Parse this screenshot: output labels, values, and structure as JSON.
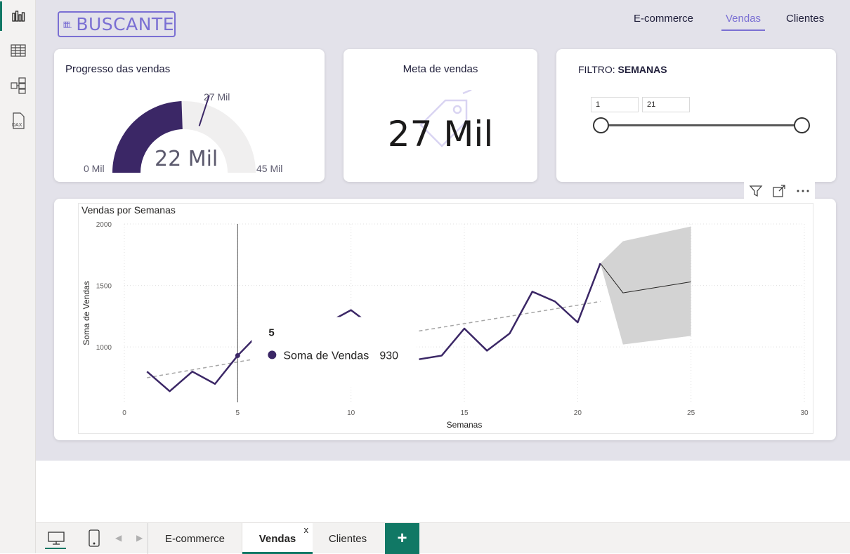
{
  "app": {
    "logo_text": "BUSCANTE",
    "nav": [
      {
        "label": "E-commerce"
      },
      {
        "label": "Vendas"
      },
      {
        "label": "Clientes"
      }
    ]
  },
  "left_rail": {
    "items": [
      {
        "icon": "report-view-icon"
      },
      {
        "icon": "table-view-icon"
      },
      {
        "icon": "model-view-icon"
      },
      {
        "icon": "dax-query-icon"
      }
    ]
  },
  "gauge_card": {
    "title": "Progresso das vendas",
    "value_label": "22 Mil",
    "min_label": "0 Mil",
    "max_label": "45 Mil",
    "target_label": "27 Mil",
    "value": 22,
    "min": 0,
    "max": 45,
    "target": 27,
    "fill_color": "#3b2766"
  },
  "kpi_card": {
    "title": "Meta de vendas",
    "value": "27 Mil",
    "icon": "price-tag-icon"
  },
  "filter_card": {
    "title_prefix": "FILTRO: ",
    "title_bold": "SEMANAS",
    "range_min": "1",
    "range_max": "21"
  },
  "visual_header": {
    "icons": [
      "filter-icon",
      "focus-mode-icon",
      "more-options-icon"
    ]
  },
  "chart_data": {
    "type": "line",
    "title": "Vendas por Semanas",
    "xlabel": "Semanas",
    "ylabel": "Soma de Vendas",
    "xlim": [
      0,
      30
    ],
    "ylim": [
      550,
      2000
    ],
    "x_ticks": [
      "0",
      "5",
      "10",
      "15",
      "20",
      "25",
      "30"
    ],
    "y_ticks": [
      "1000",
      "1500",
      "2000"
    ],
    "series": [
      {
        "name": "Soma de Vendas",
        "color": "#3b2766",
        "points": [
          [
            1,
            800
          ],
          [
            2,
            640
          ],
          [
            3,
            800
          ],
          [
            4,
            700
          ],
          [
            5,
            930
          ],
          [
            6,
            1120
          ],
          [
            7,
            null
          ],
          [
            8,
            null
          ],
          [
            9,
            1200
          ],
          [
            10,
            1300
          ],
          [
            11,
            1160
          ],
          [
            12,
            null
          ],
          [
            13,
            900
          ],
          [
            14,
            930
          ],
          [
            15,
            1150
          ],
          [
            16,
            970
          ],
          [
            17,
            1110
          ],
          [
            18,
            1450
          ],
          [
            19,
            1370
          ],
          [
            20,
            1200
          ],
          [
            21,
            1680
          ]
        ]
      }
    ],
    "trend_segments": [
      [
        [
          1,
          750
        ],
        [
          6,
          910
        ]
      ],
      [
        [
          13,
          1130
        ],
        [
          21,
          1370
        ]
      ]
    ],
    "forecast": {
      "color": "#d3d3d3",
      "line": [
        [
          21,
          1680
        ],
        [
          22,
          1440
        ],
        [
          25,
          1530
        ]
      ],
      "upper": [
        [
          21,
          1680
        ],
        [
          22,
          1860
        ],
        [
          25,
          1980
        ]
      ],
      "lower": [
        [
          21,
          1680
        ],
        [
          22,
          1020
        ],
        [
          25,
          1090
        ]
      ]
    },
    "hover_x": 5,
    "tooltip": {
      "header": "5",
      "series_label": "Soma de Vendas",
      "value": "930"
    }
  },
  "page_tabs": {
    "tabs": [
      {
        "label": "E-commerce"
      },
      {
        "label": "Vendas",
        "close": "x"
      },
      {
        "label": "Clientes"
      }
    ],
    "add_label": "+"
  },
  "bottom_bar": {
    "icons": [
      "desktop-layout-icon",
      "mobile-layout-icon",
      "prev-page-icon",
      "next-page-icon"
    ]
  }
}
